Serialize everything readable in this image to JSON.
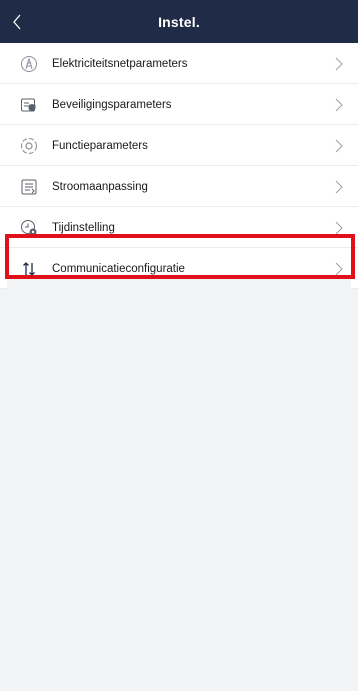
{
  "header": {
    "title": "Instel.",
    "back_icon": "chevron-left-icon"
  },
  "settings": {
    "items": [
      {
        "label": "Elektriciteitsnetparameters",
        "icon": "grid-tower-icon"
      },
      {
        "label": "Beveiligingsparameters",
        "icon": "shield-list-icon"
      },
      {
        "label": "Functieparameters",
        "icon": "function-circle-icon"
      },
      {
        "label": "Stroomaanpassing",
        "icon": "power-adjust-icon"
      },
      {
        "label": "Tijdinstelling",
        "icon": "clock-gear-icon"
      },
      {
        "label": "Communicatieconfiguratie",
        "icon": "transfer-arrows-icon",
        "highlighted": true
      }
    ]
  },
  "colors": {
    "header_bg": "#1f2b47",
    "highlight": "#e0101a",
    "page_bg": "#f2f3f5"
  }
}
